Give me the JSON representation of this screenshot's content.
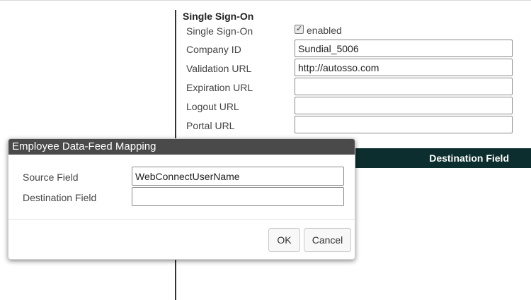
{
  "sso": {
    "section_title": "Single Sign-On",
    "rows": [
      {
        "label": "Single Sign-On",
        "checkbox_label": "enabled",
        "checked": true
      },
      {
        "label": "Company ID",
        "value": "Sundial_5006"
      },
      {
        "label": "Validation URL",
        "value": "http://autosso.com"
      },
      {
        "label": "Expiration URL",
        "value": ""
      },
      {
        "label": "Logout URL",
        "value": ""
      },
      {
        "label": "Portal URL",
        "value": ""
      }
    ]
  },
  "grid": {
    "header_destination": "Destination Field",
    "header_color": "#0d2e2e"
  },
  "dialog": {
    "title": "Employee Data-Feed Mapping",
    "source_label": "Source Field",
    "source_value": "WebConnectUserName",
    "destination_label": "Destination Field",
    "destination_value": "",
    "ok_label": "OK",
    "cancel_label": "Cancel"
  }
}
